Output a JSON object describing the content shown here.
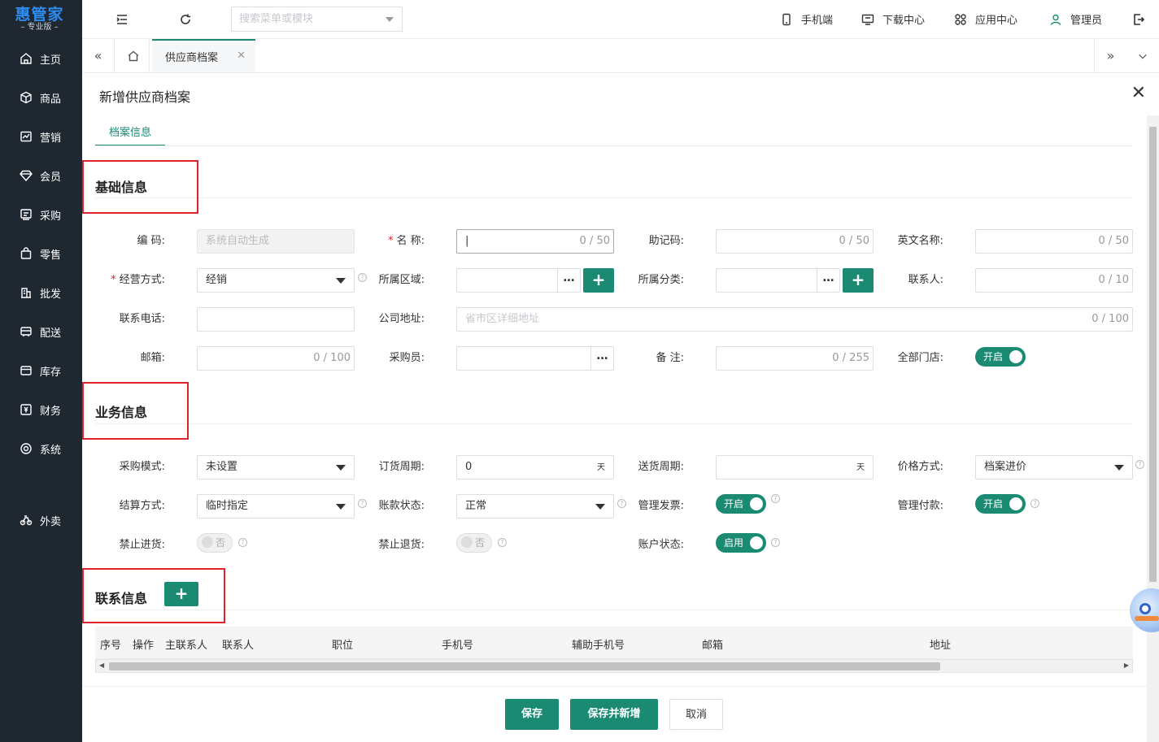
{
  "brand": {
    "name": "惠管家",
    "edition": "专业版"
  },
  "sidebar": {
    "items": [
      {
        "label": "主页",
        "icon": "home-icon"
      },
      {
        "label": "商品",
        "icon": "box-icon"
      },
      {
        "label": "营销",
        "icon": "chart-icon"
      },
      {
        "label": "会员",
        "icon": "diamond-icon"
      },
      {
        "label": "采购",
        "icon": "purchase-icon"
      },
      {
        "label": "零售",
        "icon": "bag-icon"
      },
      {
        "label": "批发",
        "icon": "building-icon"
      },
      {
        "label": "配送",
        "icon": "truck-icon"
      },
      {
        "label": "库存",
        "icon": "warehouse-icon"
      },
      {
        "label": "财务",
        "icon": "finance-icon"
      },
      {
        "label": "系统",
        "icon": "system-icon"
      },
      {
        "label": "外卖",
        "icon": "bike-icon"
      }
    ]
  },
  "topbar": {
    "search_placeholder": "搜索菜单或模块",
    "links": {
      "mobile": "手机端",
      "download": "下载中心",
      "apps": "应用中心",
      "user": "管理员"
    }
  },
  "tabs": {
    "active": "供应商档案"
  },
  "panel": {
    "title": "新增供应商档案",
    "sub_tab": "档案信息",
    "sections": {
      "basic": "基础信息",
      "business": "业务信息",
      "contact": "联系信息"
    }
  },
  "basic": {
    "code": {
      "label": "编 码:",
      "placeholder": "系统自动生成"
    },
    "name": {
      "label": "名 称:",
      "count": "0 / 50"
    },
    "mnemonic": {
      "label": "助记码:",
      "count": "0 / 50"
    },
    "english_name": {
      "label": "英文名称:",
      "count": "0 / 50"
    },
    "business_mode": {
      "label": "经营方式:",
      "value": "经销"
    },
    "region": {
      "label": "所属区域:"
    },
    "category": {
      "label": "所属分类:"
    },
    "contact": {
      "label": "联系人:",
      "count": "0 / 10"
    },
    "phone": {
      "label": "联系电话:"
    },
    "address": {
      "label": "公司地址:",
      "placeholder": "省市区详细地址",
      "count": "0 / 100"
    },
    "email": {
      "label": "邮箱:",
      "count": "0 / 100"
    },
    "buyer": {
      "label": "采购员:"
    },
    "remark": {
      "label": "备 注:",
      "count": "0 / 255"
    },
    "all_stores": {
      "label": "全部门店:",
      "value": "开启"
    }
  },
  "business": {
    "purchase_mode": {
      "label": "采购模式:",
      "value": "未设置"
    },
    "order_cycle": {
      "label": "订货周期:",
      "value": "0",
      "unit": "天"
    },
    "delivery_cycle": {
      "label": "送货周期:",
      "unit": "天"
    },
    "price_mode": {
      "label": "价格方式:",
      "value": "档案进价"
    },
    "settlement": {
      "label": "结算方式:",
      "value": "临时指定"
    },
    "account_status": {
      "label": "账款状态:",
      "value": "正常"
    },
    "invoice_mgmt": {
      "label": "管理发票:",
      "value": "开启"
    },
    "payment_mgmt": {
      "label": "管理付款:",
      "value": "开启"
    },
    "forbid_purchase": {
      "label": "禁止进货:",
      "value": "否"
    },
    "forbid_return": {
      "label": "禁止退货:",
      "value": "否"
    },
    "account_state": {
      "label": "账户状态:",
      "value": "启用"
    }
  },
  "contacts_table": {
    "columns": [
      "序号",
      "操作",
      "主联系人",
      "联系人",
      "职位",
      "手机号",
      "辅助手机号",
      "邮箱",
      "地址"
    ]
  },
  "footer": {
    "save": "保存",
    "save_new": "保存并新增",
    "cancel": "取消"
  },
  "colors": {
    "accent": "#1b8a72",
    "sidebar_bg": "#1f2731",
    "brand_blue": "#2d8cf0",
    "highlight_red": "#e0232a"
  }
}
